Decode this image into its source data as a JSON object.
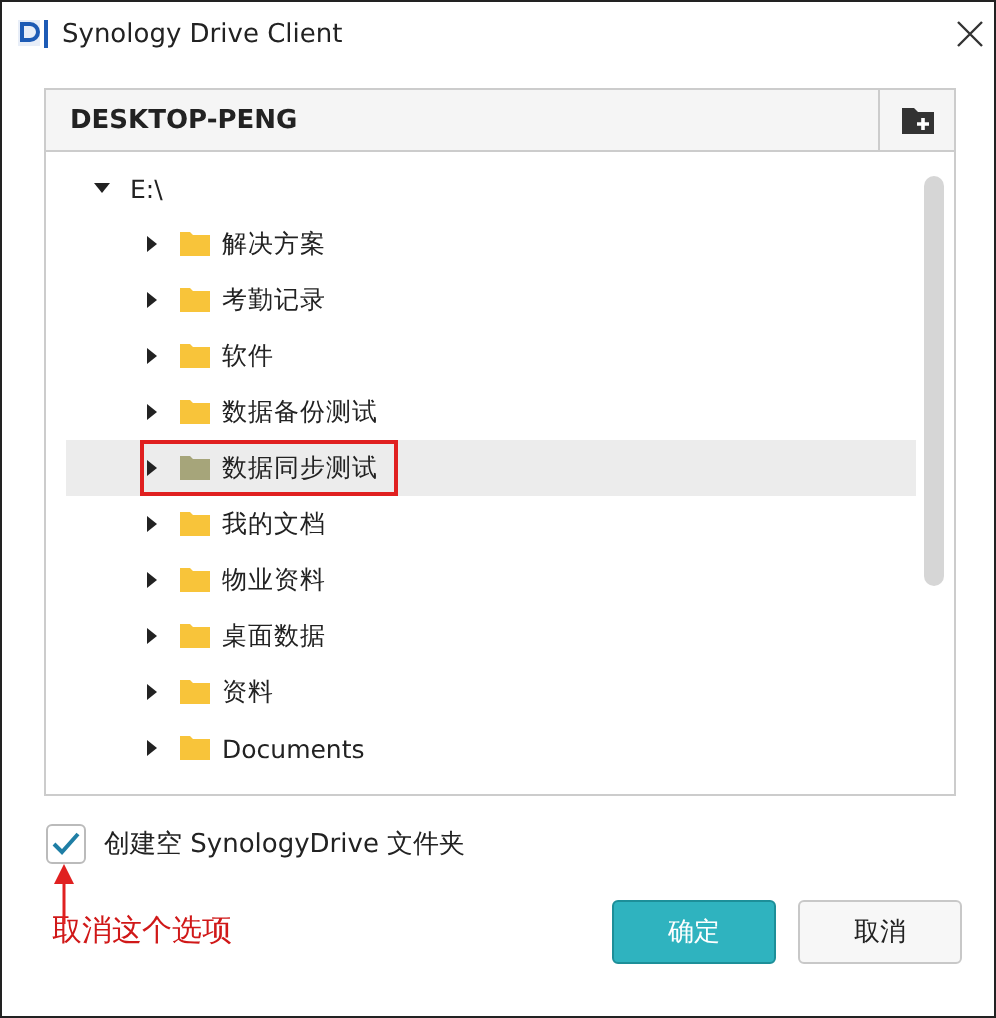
{
  "window": {
    "title": "Synology Drive Client"
  },
  "panel": {
    "title": "DESKTOP-PENG"
  },
  "tree": [
    {
      "label": "E:\\",
      "expanded": true,
      "selected": false,
      "outlined": false,
      "children": [
        {
          "label": "解决方案",
          "expanded": false,
          "selected": false,
          "outlined": false
        },
        {
          "label": "考勤记录",
          "expanded": false,
          "selected": false,
          "outlined": false
        },
        {
          "label": "软件",
          "expanded": false,
          "selected": false,
          "outlined": false
        },
        {
          "label": "数据备份测试",
          "expanded": false,
          "selected": false,
          "outlined": false
        },
        {
          "label": "数据同步测试",
          "expanded": false,
          "selected": true,
          "outlined": true
        },
        {
          "label": "我的文档",
          "expanded": false,
          "selected": false,
          "outlined": false
        },
        {
          "label": "物业资料",
          "expanded": false,
          "selected": false,
          "outlined": false
        },
        {
          "label": "桌面数据",
          "expanded": false,
          "selected": false,
          "outlined": false
        },
        {
          "label": "资料",
          "expanded": false,
          "selected": false,
          "outlined": false
        },
        {
          "label": "Documents",
          "expanded": false,
          "selected": false,
          "outlined": false
        }
      ]
    }
  ],
  "option": {
    "label": "创建空 SynologyDrive 文件夹",
    "checked": true
  },
  "note": {
    "text": "取消这个选项"
  },
  "buttons": [
    {
      "label": "确定",
      "kind": "primary"
    },
    {
      "label": "取消",
      "kind": "secondary"
    }
  ]
}
